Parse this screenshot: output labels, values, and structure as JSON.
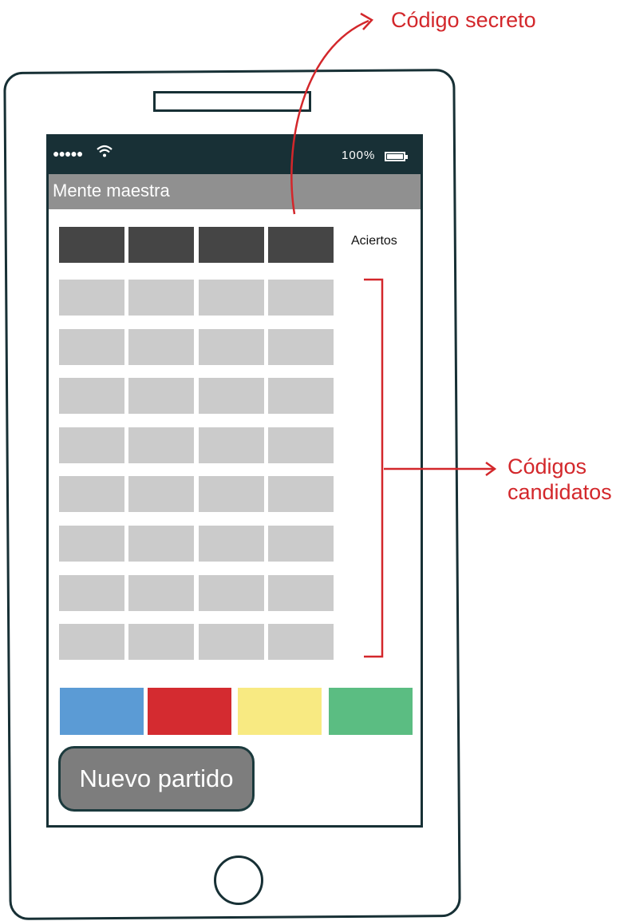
{
  "status_bar": {
    "signal": "●●●●●",
    "battery": "100%"
  },
  "app": {
    "title": "Mente maestra"
  },
  "board": {
    "hits_label": "Aciertos",
    "secret_code_slots": 4,
    "candidate_rows": 8,
    "candidate_slots_per_row": 4
  },
  "palette": {
    "colors": [
      {
        "name": "blue",
        "hex": "#5b9bd5"
      },
      {
        "name": "red",
        "hex": "#d42b30"
      },
      {
        "name": "yellow",
        "hex": "#f8ea82"
      },
      {
        "name": "green",
        "hex": "#5bbd82"
      }
    ]
  },
  "new_game_button": {
    "label": "Nuevo partido"
  },
  "annotations": {
    "secret_code": "Código secreto",
    "candidates_line1": "Códigos",
    "candidates_line2": "candidatos"
  },
  "theme": {
    "annotation_color": "#d3272b",
    "outline_color": "#173035"
  }
}
